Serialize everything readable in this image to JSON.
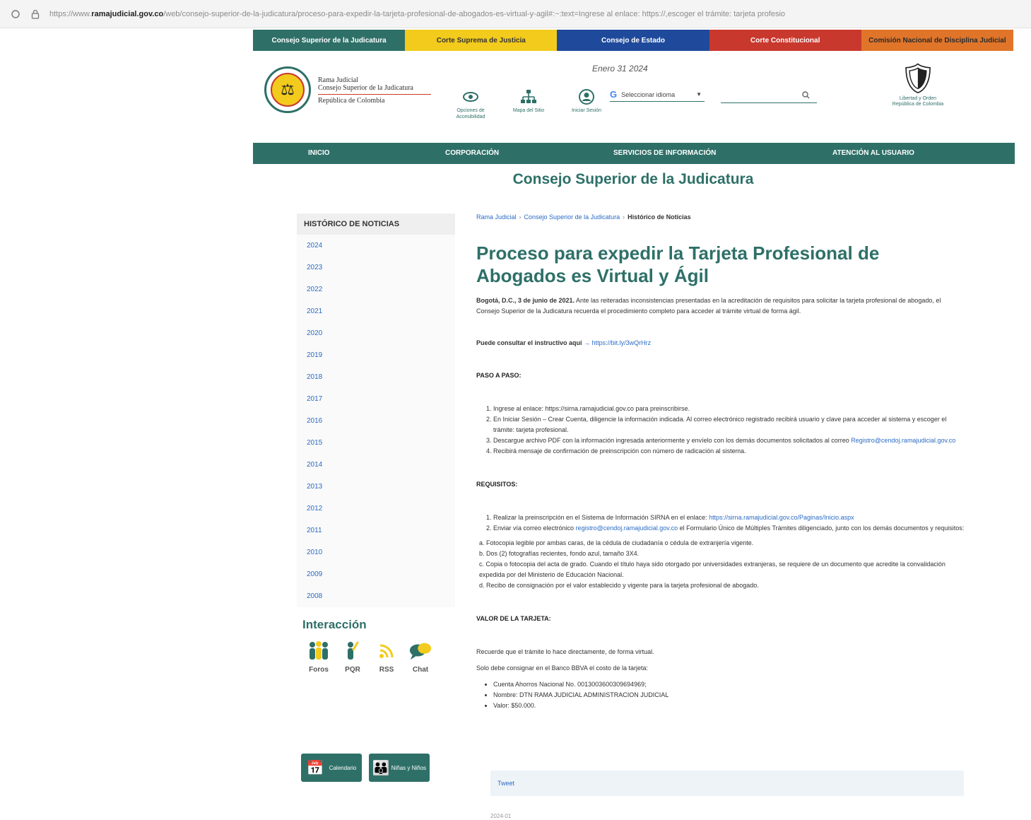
{
  "browser": {
    "url_prefix": "https://www.",
    "url_domain": "ramajudicial.gov.co",
    "url_rest": "/web/consejo-superior-de-la-judicatura/proceso-para-expedir-la-tarjeta-profesional-de-abogados-es-virtual-y-agil#:~:text=Ingrese al enlace: https://,escoger el trámite: tarjeta profesio"
  },
  "topbar": [
    "Consejo Superior de la Judicatura",
    "Corte Suprema de Justicia",
    "Consejo de Estado",
    "Corte Constitucional",
    "Comisión Nacional de Disciplina Judicial"
  ],
  "header": {
    "inst_line1": "Rama Judicial",
    "inst_line2": "Consejo Superior de la Judicatura",
    "inst_line3": "República de Colombia",
    "date": "Enero 31 2024",
    "tools": [
      {
        "label": "Opciones de Accesibilidad"
      },
      {
        "label": "Mapa del Sitio"
      },
      {
        "label": "Iniciar Sesión"
      }
    ],
    "lang_g": "G",
    "lang_label": "Seleccionar idioma",
    "search_placeholder": "",
    "shield_text": "Libertad y Orden República de Colombia"
  },
  "nav": [
    "INICIO",
    "CORPORACIÓN",
    "SERVICIOS DE INFORMACIÓN",
    "ATENCIÓN AL USUARIO"
  ],
  "site_title": "Consejo Superior de la Judicatura",
  "sidebar": {
    "heading": "HISTÓRICO DE NOTICIAS",
    "years": [
      "2024",
      "2023",
      "2022",
      "2021",
      "2020",
      "2019",
      "2018",
      "2017",
      "2016",
      "2015",
      "2014",
      "2013",
      "2012",
      "2011",
      "2010",
      "2009",
      "2008"
    ],
    "interaction_title": "Interacción",
    "social": [
      "Foros",
      "PQR",
      "RSS",
      "Chat"
    ],
    "banners": [
      "Calendario",
      "Niñas y Niños"
    ]
  },
  "main": {
    "crumbs": [
      "Rama Judicial",
      "Consejo Superior de la Judicatura",
      "Histórico de Noticias"
    ],
    "title": "Proceso para expedir la Tarjeta Profesional de Abogados es Virtual y Ágil",
    "lead_bold": "Bogotá, D.C., 3 de junio de 2021.",
    "lead_text": " Ante las reiteradas inconsistencias presentadas en la acreditación de requisitos para solicitar la tarjeta profesional de abogado, el Consejo Superior de la Judicatura recuerda el procedimiento completo para acceder al trámite virtual de forma ágil.",
    "instructivo_label": "Puede consultar el instructivo aquí",
    "instructivo_link": "https://bit.ly/3wQrHrz",
    "paso_heading": "PASO A PASO:",
    "pasos": [
      "Ingrese al enlace: https://sirna.ramajudicial.gov.co para preinscribirse.",
      "En Iniciar Sesión – Crear Cuenta, diligencie la información indicada. Al correo electrónico registrado recibirá usuario y clave para acceder al sistema y escoger el trámite: tarjeta profesional.",
      "Descargue archivo PDF con la información ingresada anteriormente y envíelo con los demás documentos solicitados al correo ",
      "Recibirá mensaje de confirmación de preinscripción con número de radicación al sistema."
    ],
    "paso3_email": "Registro@cendoj.ramajudicial.gov.co",
    "req_heading": "REQUISITOS:",
    "req1_text": "Realizar la preinscripción en el Sistema de Información SIRNA en el enlace: ",
    "req1_link": "https://sirna.ramajudicial.gov.co/Paginas/Inicio.aspx",
    "req2_text": "Enviar vía correo electrónico ",
    "req2_email": "registro@cendoj.ramajudicial.gov.co",
    "req2_text2": " el Formulario Único de Múltiples Trámites diligenciado, junto con los demás documentos y requisitos:",
    "req_sub": [
      "a. Fotocopia legible por ambas caras, de la cédula de ciudadanía o cédula de extranjería vigente.",
      "b. Dos (2) fotografías recientes, fondo azul, tamaño 3X4.",
      "c. Copia o fotocopia del acta de grado. Cuando el título haya sido otorgado por universidades extranjeras, se requiere de un documento que acredite la convalidación expedida por del Ministerio de Educación Nacional.",
      "d. Recibo de consignación por el valor establecido y vigente para la tarjeta profesional de abogado."
    ],
    "valor_heading": "VALOR DE LA TARJETA:",
    "valor_p1": "Recuerde que el trámite lo hace directamente, de forma virtual.",
    "valor_p2": "Solo debe consignar en el Banco BBVA el costo de la tarjeta:",
    "valor_items": [
      "Cuenta Ahorros Nacional No. 0013003600309694969;",
      "Nombre: DTN RAMA JUDICIAL ADMINISTRACION JUDICIAL",
      "Valor: $50.000."
    ],
    "tweet_label": "Tweet",
    "footer_date": "2024-01"
  }
}
